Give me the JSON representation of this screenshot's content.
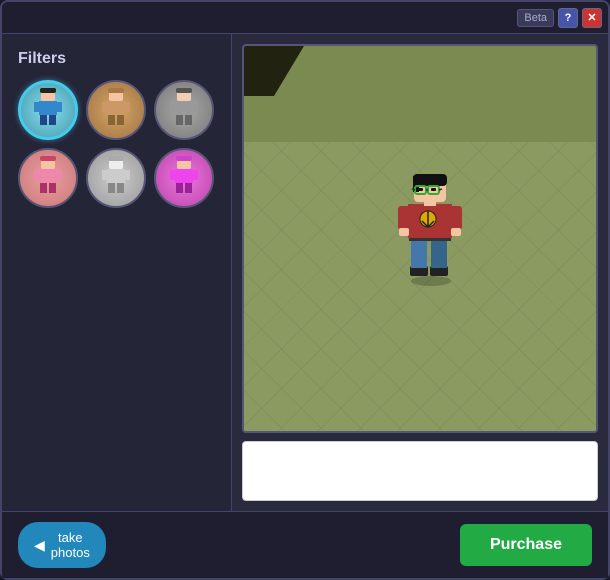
{
  "window": {
    "beta_label": "Beta",
    "help_label": "?",
    "close_label": "✕"
  },
  "filters": {
    "label": "Filters",
    "items": [
      {
        "id": "filter-cyan",
        "color": "cyan",
        "selected": true
      },
      {
        "id": "filter-tan",
        "color": "tan",
        "selected": false
      },
      {
        "id": "filter-gray",
        "color": "gray",
        "selected": false
      },
      {
        "id": "filter-pink",
        "color": "pink",
        "selected": false
      },
      {
        "id": "filter-silver",
        "color": "silver",
        "selected": false
      },
      {
        "id": "filter-magenta",
        "color": "magenta",
        "selected": false
      }
    ]
  },
  "buttons": {
    "take_photos": "take\nphotos",
    "purchase": "Purchase"
  }
}
